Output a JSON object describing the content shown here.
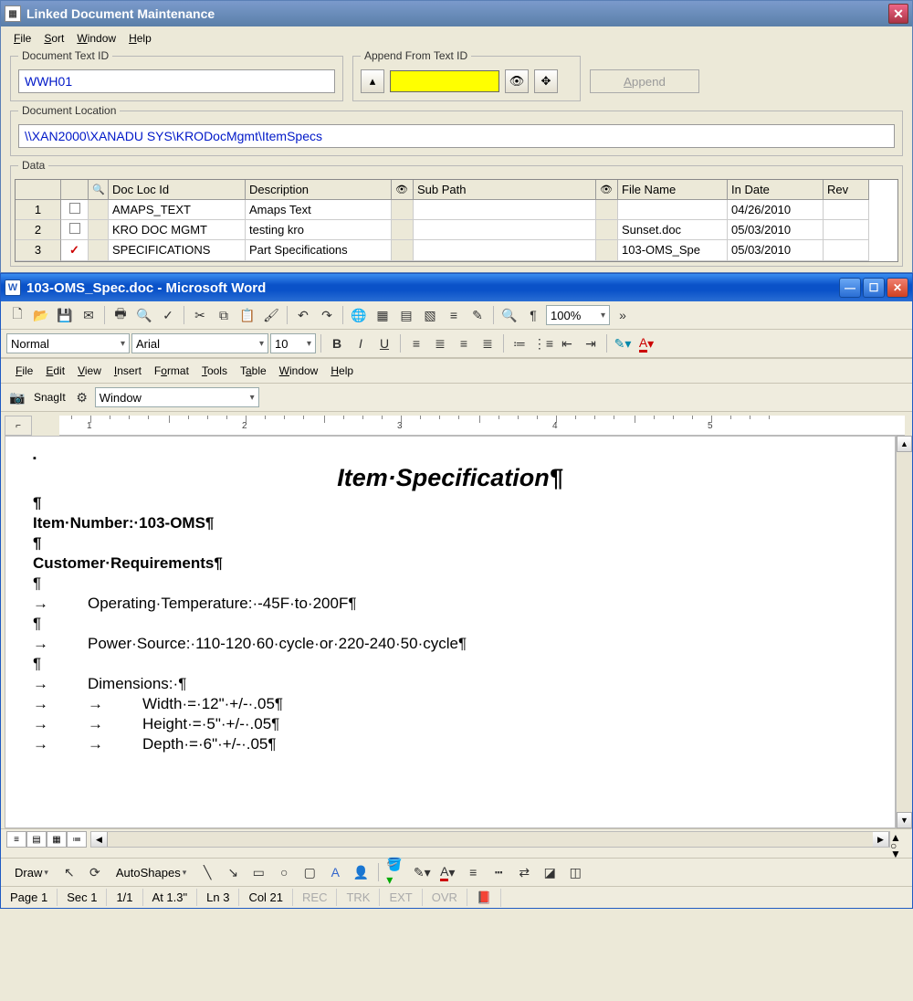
{
  "win1": {
    "title": "Linked Document Maintenance",
    "menu": {
      "file": "File",
      "sort": "Sort",
      "window": "Window",
      "help": "Help"
    },
    "docTextId": {
      "label": "Document Text ID",
      "value": "WWH01"
    },
    "appendFrom": {
      "label": "Append From Text ID"
    },
    "appendBtn": "Append",
    "docLocation": {
      "label": "Document Location",
      "value": "\\\\XAN2000\\XANADU SYS\\KRODocMgmt\\ItemSpecs"
    },
    "data": {
      "label": "Data",
      "headers": {
        "docloc": "Doc Loc Id",
        "desc": "Description",
        "sub": "Sub Path",
        "fn": "File Name",
        "date": "In Date",
        "rev": "Rev"
      },
      "rows": [
        {
          "n": "1",
          "chk": false,
          "docloc": "AMAPS_TEXT",
          "desc": "Amaps Text",
          "sub": "",
          "fn": "",
          "date": "04/26/2010",
          "rev": ""
        },
        {
          "n": "2",
          "chk": false,
          "docloc": "KRO DOC MGMT",
          "desc": "testing   kro",
          "sub": "",
          "fn": "Sunset.doc",
          "date": "05/03/2010",
          "rev": ""
        },
        {
          "n": "3",
          "chk": true,
          "docloc": "SPECIFICATIONS",
          "desc": "Part Specifications",
          "sub": "",
          "fn": "103-OMS_Spe",
          "date": "05/03/2010",
          "rev": ""
        }
      ]
    }
  },
  "win2": {
    "title": "103-OMS_Spec.doc - Microsoft Word",
    "zoom": "100%",
    "style": "Normal",
    "font": "Arial",
    "size": "10",
    "snagit": "SnagIt",
    "snagcombo": "Window",
    "menu": {
      "file": "File",
      "edit": "Edit",
      "view": "View",
      "insert": "Insert",
      "format": "Format",
      "tools": "Tools",
      "table": "Table",
      "window": "Window",
      "help": "Help"
    },
    "ruler": [
      "1",
      "2",
      "3",
      "4",
      "5"
    ],
    "doc": {
      "title": "Item·Specification¶",
      "l1": "¶",
      "l2": "Item·Number:·103-OMS¶",
      "l3": "¶",
      "l4": "Customer·Requirements¶",
      "l5": "¶",
      "l6": "Operating·Temperature:·-45F·to·200F¶",
      "l7": "¶",
      "l8": "Power·Source:·110-120·60·cycle·or·220-240·50·cycle¶",
      "l9": "¶",
      "l10": "Dimensions:·¶",
      "l11": "Width·=·12\"·+/-·.05¶",
      "l12": "Height·=·5\"·+/-·.05¶",
      "l13": "Depth·=·6\"·+/-·.05¶",
      "arrow": "→"
    },
    "draw": {
      "draw": "Draw",
      "autoshapes": "AutoShapes"
    },
    "status": {
      "page": "Page  1",
      "sec": "Sec 1",
      "pp": "1/1",
      "at": "At  1.3\"",
      "ln": "Ln  3",
      "col": "Col  21",
      "rec": "REC",
      "trk": "TRK",
      "ext": "EXT",
      "ovr": "OVR"
    }
  }
}
